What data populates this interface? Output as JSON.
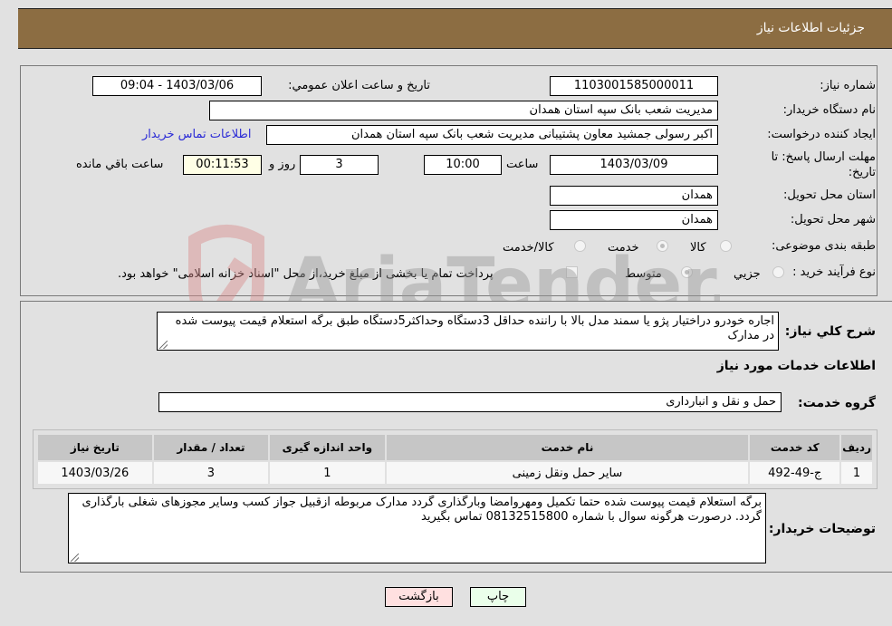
{
  "header": {
    "title": "جزئیات اطلاعات نیاز"
  },
  "form": {
    "need_number": {
      "label": "شماره نیاز:",
      "value": "1103001585000011"
    },
    "announce_datetime": {
      "label": "تاریخ و ساعت اعلان عمومي:",
      "value": "1403/03/06 - 09:04"
    },
    "buyer_org": {
      "label": "نام دستگاه خریدار:",
      "value": "مدیریت شعب بانک سپه استان همدان"
    },
    "requester": {
      "label": "ایجاد کننده درخواست:",
      "value": "اکبر رسولی جمشید معاون پشتیبانی مدیریت شعب بانک سپه استان همدان"
    },
    "buyer_contact_link": "اطلاعات تماس خریدار",
    "deadline": {
      "label": "مهلت ارسال پاسخ: تا تاریخ:",
      "date": "1403/03/09",
      "time_label": "ساعت",
      "time": "10:00",
      "days": "3",
      "days_label": "روز و",
      "remaining": "00:11:53",
      "remaining_label": "ساعت باقي مانده"
    },
    "delivery_province": {
      "label": "استان محل تحویل:",
      "value": "همدان"
    },
    "delivery_city": {
      "label": "شهر محل تحویل:",
      "value": "همدان"
    },
    "category": {
      "label": "طبقه بندی موضوعی:",
      "options": [
        "کالا",
        "خدمت",
        "کالا/خدمت"
      ],
      "selected": "خدمت"
    },
    "purchase_type": {
      "label": "نوع فرآیند خرید :",
      "options": [
        "جزيي",
        "متوسط"
      ],
      "selected": "متوسط",
      "treasury_note": "پرداخت تمام یا بخشی از مبلغ خرید،از محل \"اسناد خزانه اسلامی\" خواهد بود."
    }
  },
  "details": {
    "description_label": "شرح کلي نياز:",
    "description": "اجاره خودرو دراختیار پژو یا سمند مدل بالا با راننده حداقل 3دستگاه وحداکثر5دستگاه طبق برگه استعلام قیمت پیوست شده در مدارک",
    "services_heading": "اطلاعات خدمات مورد نياز",
    "service_group_label": "گروه خدمت:",
    "service_group": "حمل و نقل و انبارداری",
    "table": {
      "headers": [
        "ردیف",
        "کد خدمت",
        "نام خدمت",
        "واحد اندازه گیری",
        "تعداد / مقدار",
        "تاریخ نیاز"
      ],
      "rows": [
        [
          "1",
          "ج-49-492",
          "سایر حمل ونقل زمینی",
          "1",
          "3",
          "1403/03/26"
        ]
      ]
    },
    "buyer_notes_label": "توضيحات خريدار:",
    "buyer_notes": "برگه استعلام قیمت پیوست شده حتما تکمیل ومهروامضا وبارگذاری گردد مدارک مربوطه ازقبیل جواز کسب وسایر مجوزهای شغلی بارگذاری گردد. درصورت هرگونه سوال با شماره 08132515800 تماس بگیرید"
  },
  "buttons": {
    "print": "چاپ",
    "back": "بازگشت"
  },
  "watermark_text": "AriaTender.neT"
}
